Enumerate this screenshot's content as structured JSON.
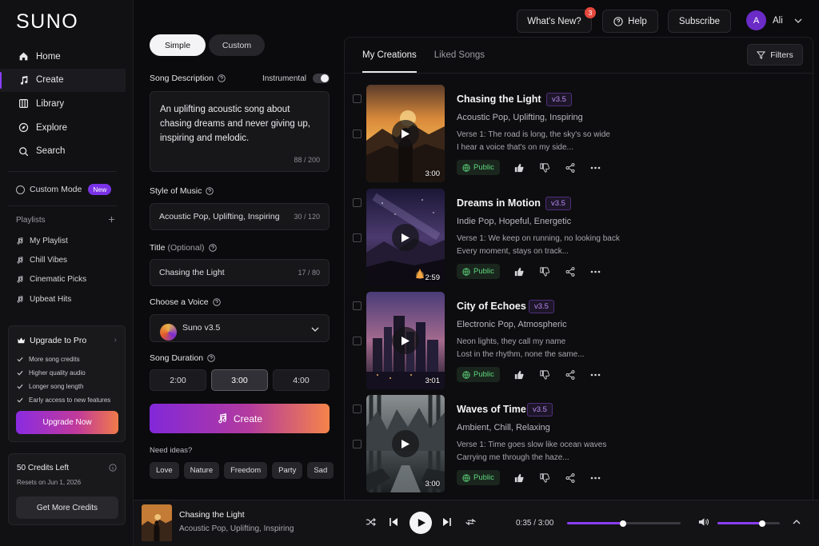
{
  "app": {
    "logo": "SUNO"
  },
  "sidebar": {
    "nav": [
      {
        "label": "Home",
        "icon": "home-icon"
      },
      {
        "label": "Create",
        "icon": "music-note-icon",
        "active": true
      },
      {
        "label": "Library",
        "icon": "library-icon"
      },
      {
        "label": "Explore",
        "icon": "compass-icon"
      },
      {
        "label": "Search",
        "icon": "search-icon"
      }
    ],
    "custom_mode": {
      "label": "Custom Mode",
      "badge": "New"
    },
    "playlists": {
      "header": "Playlists",
      "items": [
        "My Playlist",
        "Chill Vibes",
        "Cinematic Picks",
        "Upbeat Hits"
      ]
    },
    "pro": {
      "title": "Upgrade to Pro",
      "features": [
        "More song credits",
        "Higher quality audio",
        "Longer song length",
        "Early access to new features"
      ],
      "button": "Upgrade Now"
    },
    "credits": {
      "title": "50 Credits Left",
      "subtitle": "Resets on Jun 1, 2026",
      "button": "Get More Credits"
    }
  },
  "topbar": {
    "whats_new": "What's New?",
    "notif_count": "3",
    "help": "Help",
    "subscribe": "Subscribe",
    "user_initial": "A",
    "user_name": "Ali"
  },
  "form": {
    "mode_simple": "Simple",
    "mode_custom": "Custom",
    "desc_label": "Song Description",
    "instrumental_label": "Instrumental",
    "instrumental_on": false,
    "desc_value": "An uplifting acoustic song about chasing dreams and never giving up, inspiring and melodic.",
    "desc_counter": "88 / 200",
    "style_label": "Style of Music",
    "style_value": "Acoustic Pop, Uplifting, Inspiring",
    "style_counter": "30 / 120",
    "title_label": "Title",
    "title_optional": "(Optional)",
    "title_value": "Chasing the Light",
    "title_counter": "17 / 80",
    "voice_label": "Choose a Voice",
    "voice_value": "Suno v3.5",
    "duration_label": "Song Duration",
    "durations": [
      "2:00",
      "3:00",
      "4:00"
    ],
    "duration_selected": "3:00",
    "create_button": "Create",
    "ideas_label": "Need ideas?",
    "ideas": [
      "Love",
      "Nature",
      "Freedom",
      "Party",
      "Sad"
    ]
  },
  "main": {
    "tabs": [
      "My Creations",
      "Liked Songs"
    ],
    "active_tab": "My Creations",
    "filters": "Filters",
    "songs": [
      {
        "title": "Chasing the Light",
        "version": "v3.5",
        "genre": "Acoustic Pop, Uplifting, Inspiring",
        "lyric1": "Verse 1: The road is long, the sky's so wide",
        "lyric2": "I hear a voice that's on my side...",
        "duration": "3:00",
        "visibility": "Public"
      },
      {
        "title": "Dreams in Motion",
        "version": "v3.5",
        "genre": "Indie Pop, Hopeful, Energetic",
        "lyric1": "Verse 1: We keep on running, no looking back",
        "lyric2": "Every moment, stays on track...",
        "duration": "2:59",
        "visibility": "Public"
      },
      {
        "title": "City of Echoes",
        "version": "v3.5",
        "genre": "Electronic Pop, Atmospheric",
        "lyric1": "Neon lights, they call my name",
        "lyric2": "Lost in the rhythm, none the same...",
        "duration": "3:01",
        "visibility": "Public"
      },
      {
        "title": "Waves of Time",
        "version": "v3.5",
        "genre": "Ambient, Chill, Relaxing",
        "lyric1": "Verse 1: Time goes slow like ocean waves",
        "lyric2": "Carrying me through the haze...",
        "duration": "3:00",
        "visibility": "Public"
      }
    ]
  },
  "player": {
    "title": "Chasing the Light",
    "genre": "Acoustic Pop, Uplifting, Inspiring",
    "time": "0:35 / 3:00",
    "progress": 0.49,
    "volume": 0.72
  },
  "colors": {
    "accent": "#8a3cf0",
    "public_green": "#5fd77e",
    "badge_red": "#e5483d"
  }
}
